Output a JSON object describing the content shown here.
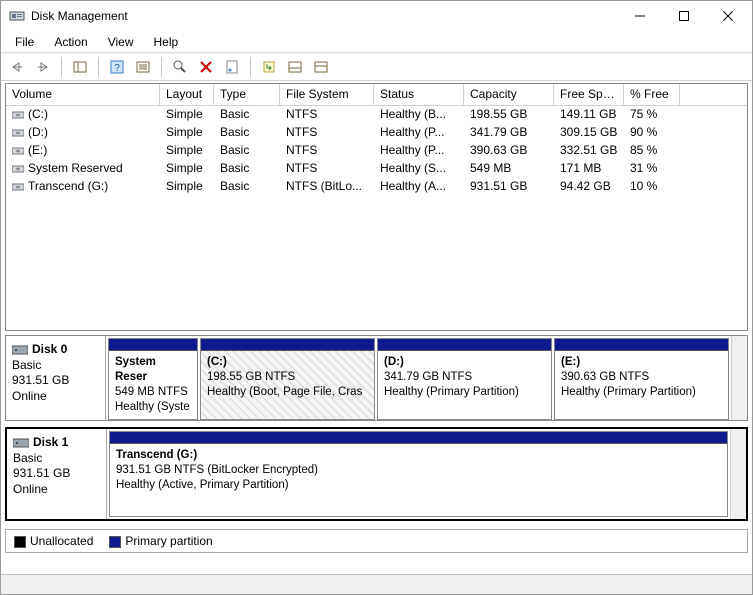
{
  "window": {
    "title": "Disk Management"
  },
  "menus": {
    "file": "File",
    "action": "Action",
    "view": "View",
    "help": "Help"
  },
  "columns": {
    "volume": "Volume",
    "layout": "Layout",
    "type": "Type",
    "file_system": "File System",
    "status": "Status",
    "capacity": "Capacity",
    "free_space": "Free Spa...",
    "pct_free": "% Free"
  },
  "volumes": [
    {
      "name": "(C:)",
      "layout": "Simple",
      "type": "Basic",
      "fs": "NTFS",
      "status": "Healthy (B...",
      "capacity": "198.55 GB",
      "free": "149.11 GB",
      "pct": "75 %"
    },
    {
      "name": "(D:)",
      "layout": "Simple",
      "type": "Basic",
      "fs": "NTFS",
      "status": "Healthy (P...",
      "capacity": "341.79 GB",
      "free": "309.15 GB",
      "pct": "90 %"
    },
    {
      "name": "(E:)",
      "layout": "Simple",
      "type": "Basic",
      "fs": "NTFS",
      "status": "Healthy (P...",
      "capacity": "390.63 GB",
      "free": "332.51 GB",
      "pct": "85 %"
    },
    {
      "name": "System Reserved",
      "layout": "Simple",
      "type": "Basic",
      "fs": "NTFS",
      "status": "Healthy (S...",
      "capacity": "549 MB",
      "free": "171 MB",
      "pct": "31 %"
    },
    {
      "name": "Transcend (G:)",
      "layout": "Simple",
      "type": "Basic",
      "fs": "NTFS (BitLo...",
      "status": "Healthy (A...",
      "capacity": "931.51 GB",
      "free": "94.42 GB",
      "pct": "10 %"
    }
  ],
  "disk0": {
    "name": "Disk 0",
    "type": "Basic",
    "size": "931.51 GB",
    "state": "Online",
    "parts": [
      {
        "title": "System Reser",
        "line2": "549 MB NTFS",
        "line3": "Healthy (Syste"
      },
      {
        "title": "(C:)",
        "line2": "198.55 GB NTFS",
        "line3": "Healthy (Boot, Page File, Cras"
      },
      {
        "title": "(D:)",
        "line2": "341.79 GB NTFS",
        "line3": "Healthy (Primary Partition)"
      },
      {
        "title": "(E:)",
        "line2": "390.63 GB NTFS",
        "line3": "Healthy (Primary Partition)"
      }
    ]
  },
  "disk1": {
    "name": "Disk 1",
    "type": "Basic",
    "size": "931.51 GB",
    "state": "Online",
    "parts": [
      {
        "title": "Transcend  (G:)",
        "line2": "931.51 GB NTFS (BitLocker Encrypted)",
        "line3": "Healthy (Active, Primary Partition)"
      }
    ]
  },
  "legend": {
    "unallocated": "Unallocated",
    "primary": "Primary partition"
  },
  "colors": {
    "primary_partition": "#0f1b8c",
    "unallocated": "#000000"
  }
}
